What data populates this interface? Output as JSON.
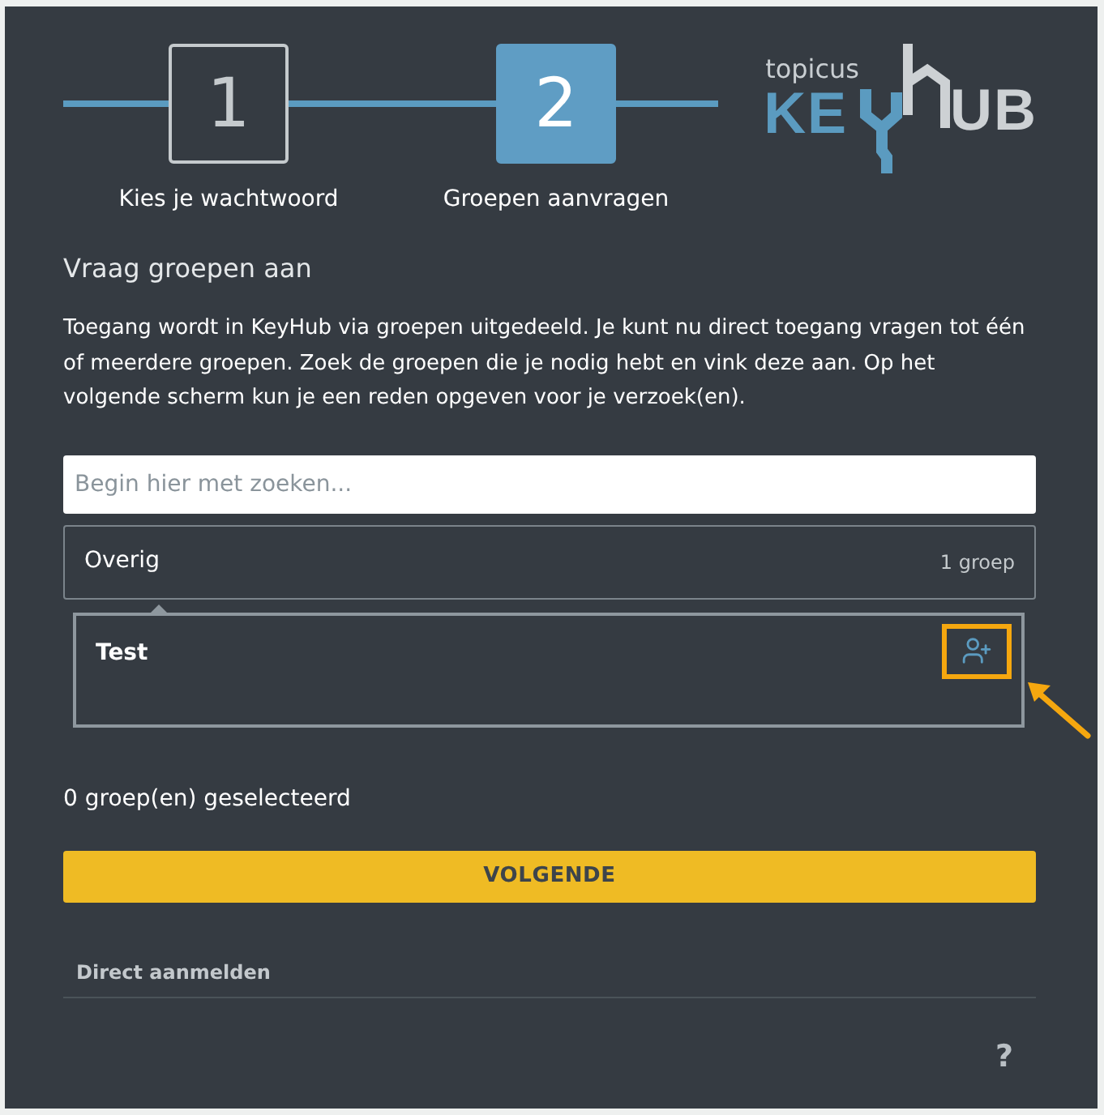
{
  "steps": [
    {
      "number": "1",
      "label": "Kies je wachtwoord",
      "selected": false
    },
    {
      "number": "2",
      "label": "Groepen aanvragen",
      "selected": true
    }
  ],
  "logo": {
    "tagline": "topicus",
    "word_start": "KE",
    "word_end": "UB"
  },
  "heading": "Vraag groepen aan",
  "intro": "Toegang wordt in KeyHub via groepen uitgedeeld. Je kunt nu direct toegang vragen tot één of meerdere groepen. Zoek de groepen die je nodig hebt en vink deze aan. Op het volgende scherm kun je een reden opgeven voor je verzoek(en).",
  "search": {
    "placeholder": "Begin hier met zoeken..."
  },
  "categories": [
    {
      "name": "Overig",
      "count": "1 groep",
      "expanded": true,
      "groups": [
        {
          "name": "Test",
          "highlighted": true
        }
      ]
    }
  ],
  "selection_summary": "0 groep(en) geselecteerd",
  "next_button": "VOLGENDE",
  "direct_signin": "Direct aanmelden",
  "help": "?"
}
